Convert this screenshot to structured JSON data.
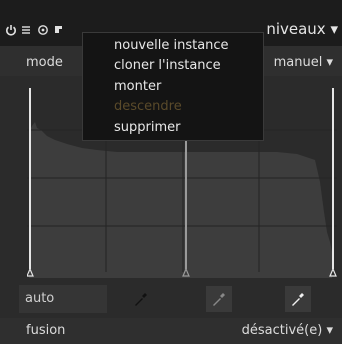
{
  "header": {
    "title": "niveaux",
    "icons": [
      "power-icon",
      "presets-icon",
      "reset-icon",
      "multi-instance-icon"
    ]
  },
  "mode": {
    "label": "mode",
    "value": "manuel"
  },
  "auto": {
    "label": "auto"
  },
  "fusion": {
    "label": "fusion",
    "value": "désactivé(e)"
  },
  "context_menu": {
    "items": [
      {
        "label": "nouvelle instance",
        "enabled": true
      },
      {
        "label": "cloner l'instance",
        "enabled": true
      },
      {
        "label": "monter",
        "enabled": true
      },
      {
        "label": "descendre",
        "enabled": false
      },
      {
        "label": "supprimer",
        "enabled": true
      }
    ]
  },
  "colors": {
    "accent": "#dcdcdc",
    "disabled": "#5a4a2a",
    "histogram": "#3d3d3d"
  }
}
